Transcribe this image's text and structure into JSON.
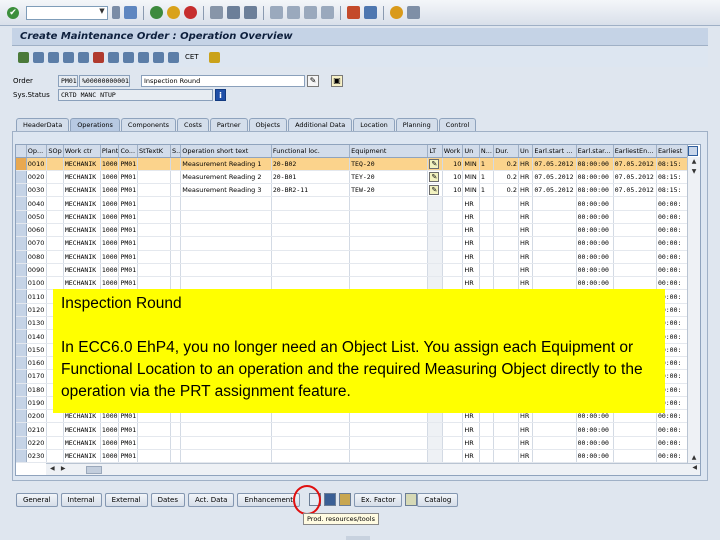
{
  "system_toolbar": {
    "command_value": "",
    "icons": [
      "ok-icon",
      "save-icon",
      "back-icon",
      "exit-icon",
      "cancel-icon",
      "print-icon",
      "find-icon",
      "find-next-icon",
      "first-page-icon",
      "prev-page-icon",
      "next-page-icon",
      "last-page-icon",
      "new-session-icon",
      "shortcut-icon",
      "help-icon",
      "customize-icon"
    ]
  },
  "title": "Create Maintenance Order : Operation Overview",
  "app_toolbar": {
    "cet_label": "CET"
  },
  "header": {
    "order_label": "Order",
    "order_type": "PM01",
    "order_number": "%00000000001",
    "order_text": "Inspection Round",
    "status_label": "Sys.Status",
    "status_value": "CRTD MANC NTUP"
  },
  "tabs": [
    "HeaderData",
    "Operations",
    "Components",
    "Costs",
    "Partner",
    "Objects",
    "Additional Data",
    "Location",
    "Planning",
    "Control"
  ],
  "active_tab": "Operations",
  "grid": {
    "columns": [
      "Op...",
      "SOp",
      "Work ctr",
      "Plant",
      "Co...",
      "StTextK",
      "S...",
      "Operation short text",
      "Functional loc.",
      "Equipment",
      "LT",
      "Work",
      "Un",
      "N...",
      "Dur.",
      "Un",
      "Earl.start ...",
      "Earl.star...",
      "EarliestEn...",
      "Earliest"
    ],
    "rows": [
      [
        "0010",
        "",
        "MECHANIK",
        "1000",
        "PM01",
        "",
        "",
        "Measurement Reading 1",
        "20-B02",
        "TEQ-20",
        "LT",
        "10",
        "MIN",
        "1",
        "0.2",
        "HR",
        "07.05.2012",
        "08:00:00",
        "07.05.2012",
        "08:15:"
      ],
      [
        "0020",
        "",
        "MECHANIK",
        "1000",
        "PM01",
        "",
        "",
        "Measurement Reading 2",
        "20-B01",
        "TEY-20",
        "LT",
        "10",
        "MIN",
        "1",
        "0.2",
        "HR",
        "07.05.2012",
        "08:00:00",
        "07.05.2012",
        "08:15:"
      ],
      [
        "0030",
        "",
        "MECHANIK",
        "1000",
        "PM01",
        "",
        "",
        "Measurement Reading 3",
        "20-BR2-11",
        "TEW-20",
        "LT",
        "10",
        "MIN",
        "1",
        "0.2",
        "HR",
        "07.05.2012",
        "08:00:00",
        "07.05.2012",
        "08:15:"
      ],
      [
        "0040",
        "",
        "MECHANIK",
        "1000",
        "PM01",
        "",
        "",
        "",
        "",
        "",
        "",
        "",
        "HR",
        "",
        "",
        "HR",
        "",
        "00:00:00",
        "",
        "00:00:"
      ],
      [
        "0050",
        "",
        "MECHANIK",
        "1000",
        "PM01",
        "",
        "",
        "",
        "",
        "",
        "",
        "",
        "HR",
        "",
        "",
        "HR",
        "",
        "00:00:00",
        "",
        "00:00:"
      ],
      [
        "0060",
        "",
        "MECHANIK",
        "1000",
        "PM01",
        "",
        "",
        "",
        "",
        "",
        "",
        "",
        "HR",
        "",
        "",
        "HR",
        "",
        "00:00:00",
        "",
        "00:00:"
      ],
      [
        "0070",
        "",
        "MECHANIK",
        "1000",
        "PM01",
        "",
        "",
        "",
        "",
        "",
        "",
        "",
        "HR",
        "",
        "",
        "HR",
        "",
        "00:00:00",
        "",
        "00:00:"
      ],
      [
        "0080",
        "",
        "MECHANIK",
        "1000",
        "PM01",
        "",
        "",
        "",
        "",
        "",
        "",
        "",
        "HR",
        "",
        "",
        "HR",
        "",
        "00:00:00",
        "",
        "00:00:"
      ],
      [
        "0090",
        "",
        "MECHANIK",
        "1000",
        "PM01",
        "",
        "",
        "",
        "",
        "",
        "",
        "",
        "HR",
        "",
        "",
        "HR",
        "",
        "00:00:00",
        "",
        "00:00:"
      ],
      [
        "0100",
        "",
        "MECHANIK",
        "1000",
        "PM01",
        "",
        "",
        "",
        "",
        "",
        "",
        "",
        "HR",
        "",
        "",
        "HR",
        "",
        "00:00:00",
        "",
        "00:00:"
      ],
      [
        "0110",
        "",
        "",
        "",
        "",
        "",
        "",
        "",
        "",
        "",
        "",
        "",
        "",
        "",
        "",
        "",
        "",
        "",
        "",
        "00:00:"
      ],
      [
        "0120",
        "",
        "",
        "",
        "",
        "",
        "",
        "",
        "",
        "",
        "",
        "",
        "",
        "",
        "",
        "",
        "",
        "",
        "",
        "00:00:"
      ],
      [
        "0130",
        "",
        "",
        "",
        "",
        "",
        "",
        "",
        "",
        "",
        "",
        "",
        "",
        "",
        "",
        "",
        "",
        "",
        "",
        "00:00:"
      ],
      [
        "0140",
        "",
        "",
        "",
        "",
        "",
        "",
        "",
        "",
        "",
        "",
        "",
        "",
        "",
        "",
        "",
        "",
        "",
        "",
        "00:00:"
      ],
      [
        "0150",
        "",
        "",
        "",
        "",
        "",
        "",
        "",
        "",
        "",
        "",
        "",
        "",
        "",
        "",
        "",
        "",
        "",
        "",
        "00:00:"
      ],
      [
        "0160",
        "",
        "",
        "",
        "",
        "",
        "",
        "",
        "",
        "",
        "",
        "",
        "",
        "",
        "",
        "",
        "",
        "",
        "",
        "00:00:"
      ],
      [
        "0170",
        "",
        "",
        "",
        "",
        "",
        "",
        "",
        "",
        "",
        "",
        "",
        "",
        "",
        "",
        "",
        "",
        "",
        "",
        "00:00:"
      ],
      [
        "0180",
        "",
        "",
        "",
        "",
        "",
        "",
        "",
        "",
        "",
        "",
        "",
        "",
        "",
        "",
        "",
        "",
        "",
        "",
        "00:00:"
      ],
      [
        "0190",
        "",
        "",
        "",
        "",
        "",
        "",
        "",
        "",
        "",
        "",
        "",
        "",
        "",
        "",
        "",
        "",
        "",
        "",
        "00:00:"
      ],
      [
        "0200",
        "",
        "MECHANIK",
        "1000",
        "PM01",
        "",
        "",
        "",
        "",
        "",
        "",
        "",
        "HR",
        "",
        "",
        "HR",
        "",
        "00:00:00",
        "",
        "00:00:"
      ],
      [
        "0210",
        "",
        "MECHANIK",
        "1000",
        "PM01",
        "",
        "",
        "",
        "",
        "",
        "",
        "",
        "HR",
        "",
        "",
        "HR",
        "",
        "00:00:00",
        "",
        "00:00:"
      ],
      [
        "0220",
        "",
        "MECHANIK",
        "1000",
        "PM01",
        "",
        "",
        "",
        "",
        "",
        "",
        "",
        "HR",
        "",
        "",
        "HR",
        "",
        "00:00:00",
        "",
        "00:00:"
      ],
      [
        "0230",
        "",
        "MECHANIK",
        "1000",
        "PM01",
        "",
        "",
        "",
        "",
        "",
        "",
        "",
        "HR",
        "",
        "",
        "HR",
        "",
        "00:00:00",
        "",
        "00:00:"
      ]
    ],
    "highlight_row_color": "#fbd38c"
  },
  "callout": {
    "title": "Inspection Round",
    "body": "In ECC6.0 EhP4, you no longer need an Object List. You assign each Equipment or Functional Location to an operation and the required Measuring Object directly to the operation via the PRT assignment feature.",
    "background": "#ffff00"
  },
  "bottom_buttons": {
    "general": "General",
    "internal": "Internal",
    "external": "External",
    "dates": "Dates",
    "act_data": "Act. Data",
    "enhancement": "Enhancement",
    "ex_factor": "Ex. Factor",
    "catalog": "Catalog"
  },
  "tooltip": "Prod. resources/tools"
}
